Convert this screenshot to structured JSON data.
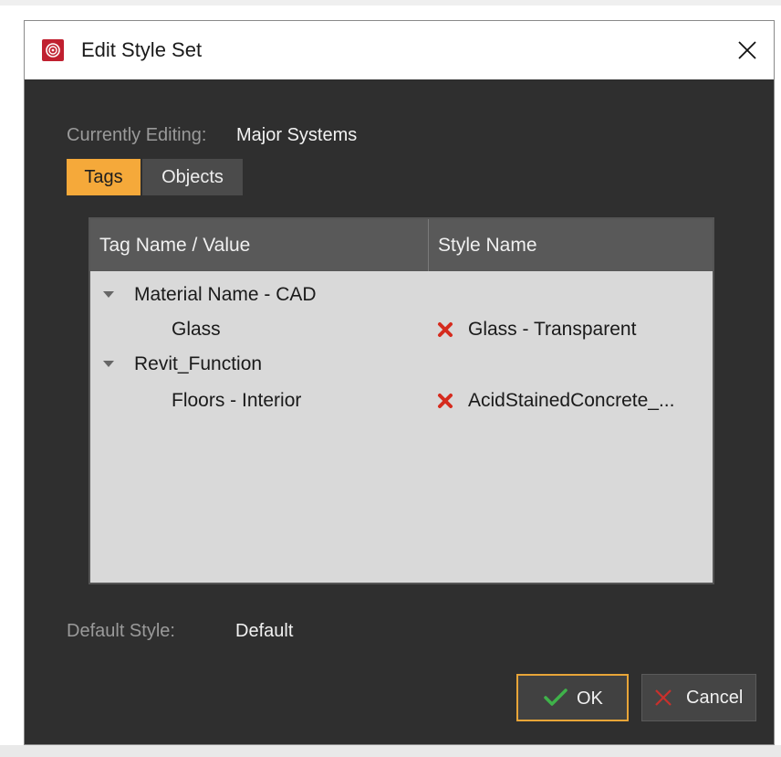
{
  "window": {
    "title": "Edit Style Set"
  },
  "editing": {
    "label": "Currently Editing:",
    "value": "Major Systems"
  },
  "tabs": [
    {
      "label": "Tags",
      "selected": true
    },
    {
      "label": "Objects",
      "selected": false
    }
  ],
  "table": {
    "columns": [
      "Tag Name / Value",
      "Style Name"
    ],
    "groups": [
      {
        "name": "Material Name - CAD",
        "expanded": true,
        "children": [
          {
            "value": "Glass",
            "style": "Glass - Transparent",
            "status_icon": "red-x-icon"
          }
        ]
      },
      {
        "name": "Revit_Function",
        "expanded": true,
        "children": [
          {
            "value": "Floors - Interior",
            "style": "AcidStainedConcrete_...",
            "status_icon": "red-x-icon"
          }
        ]
      }
    ]
  },
  "default_style": {
    "label": "Default Style:",
    "value": "Default"
  },
  "buttons": {
    "ok": "OK",
    "cancel": "Cancel"
  },
  "colors": {
    "accent": "#f5a93a",
    "panel_bg": "#2f2f2f",
    "table_bg": "#d9d9d9",
    "error": "#d52b1e",
    "ok_check": "#3fb24a",
    "app_icon": "#c02030"
  }
}
